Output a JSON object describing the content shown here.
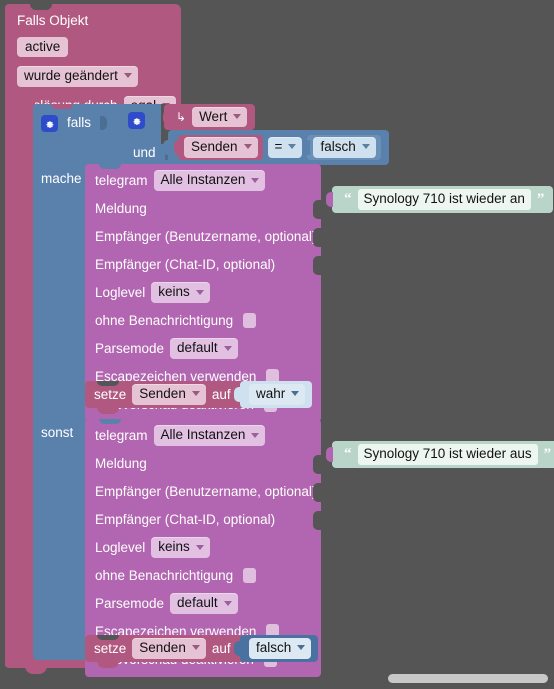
{
  "editor": {
    "name": "blockly-workspace",
    "background_color": "#555555"
  },
  "colors": {
    "trigger_block": "#b0587f",
    "control_block": "#5a81ab",
    "telegram_block": "#b265b0",
    "text_block": "#b9d5c9",
    "selected_block": "#4a72a0",
    "gear_icon": "#2e4cc9"
  },
  "trigger": {
    "title": "Falls Objekt",
    "object_id": "active",
    "change_type": "wurde geändert",
    "source_label": "Auslösung durch",
    "source_value": "egal"
  },
  "control": {
    "if_label": "falls",
    "and_label": "und",
    "do_label": "mache",
    "else_label": "sonst"
  },
  "condition": {
    "value_block": "Wert",
    "variable": "Senden",
    "operator": "=",
    "compare_value": "falsch"
  },
  "telegram_do": {
    "block_name": "telegram",
    "instance": "Alle Instanzen",
    "message_label": "Meldung",
    "recipient_user_label": "Empfänger (Benutzername, optional)",
    "recipient_chat_label": "Empfänger (Chat-ID, optional)",
    "loglevel_label": "Loglevel",
    "loglevel_value": "keins",
    "silent_label": "ohne Benachrichtigung",
    "parsemode_label": "Parsemode",
    "parsemode_value": "default",
    "escape_label": "Escapezeichen verwenden",
    "webpreview_label": "Webvorschau deaktivieren"
  },
  "telegram_else": {
    "block_name": "telegram",
    "instance": "Alle Instanzen",
    "message_label": "Meldung",
    "recipient_user_label": "Empfänger (Benutzername, optional)",
    "recipient_chat_label": "Empfänger (Chat-ID, optional)",
    "loglevel_label": "Loglevel",
    "loglevel_value": "keins",
    "silent_label": "ohne Benachrichtigung",
    "parsemode_label": "Parsemode",
    "parsemode_value": "default",
    "escape_label": "Escapezeichen verwenden",
    "webpreview_label": "Webvorschau deaktivieren"
  },
  "text_do": {
    "quote_open": "“",
    "quote_close": "”",
    "value": "Synology 710 ist wieder an"
  },
  "text_else": {
    "quote_open": "“",
    "quote_close": "”",
    "value": "Synology 710 ist wieder aus"
  },
  "setze_do": {
    "verb": "setze",
    "variable": "Senden",
    "preposition": "auf",
    "value": "wahr"
  },
  "setze_else": {
    "verb": "setze",
    "variable": "Senden",
    "preposition": "auf",
    "value": "falsch"
  }
}
